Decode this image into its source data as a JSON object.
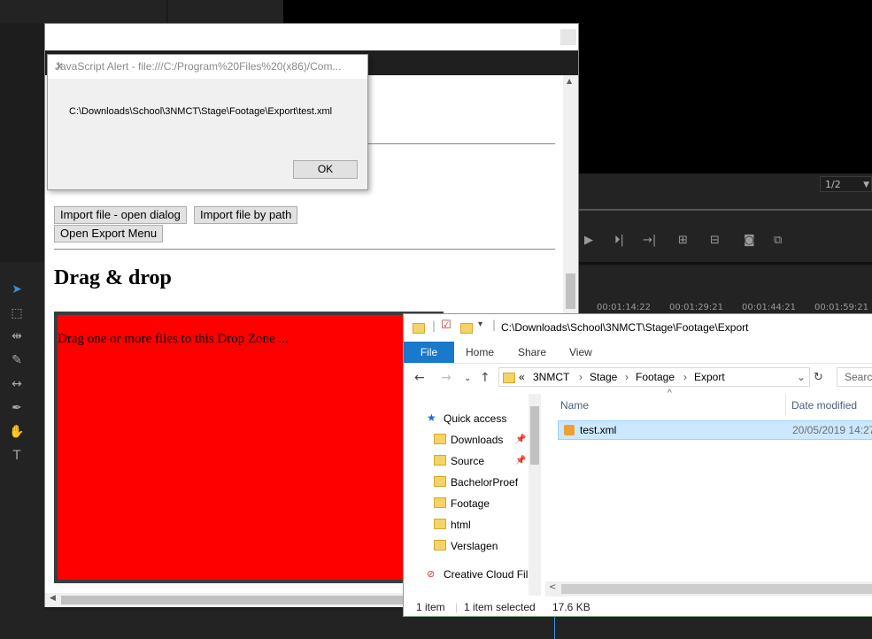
{
  "premiere": {
    "ratio": "1/2",
    "timecodes": [
      "00:01:14:22",
      "00:01:29:21",
      "00:01:44:21",
      "00:01:59:21"
    ]
  },
  "alert": {
    "title": "JavaScript Alert - file:///C:/Program%20Files%20(x86)/Com...",
    "message": "C:\\Downloads\\School\\3NMCT\\Stage\\Footage\\Export\\test.xml",
    "ok_label": "OK"
  },
  "page": {
    "buttons": {
      "import_dialog": "Import file - open dialog",
      "import_path": "Import file by path",
      "export_menu": "Open Export Menu"
    },
    "dragdrop_heading": "Drag & drop",
    "dropzone_text": "Drag one or more files to this Drop Zone ..."
  },
  "explorer": {
    "title_path": "C:\\Downloads\\School\\3NMCT\\Stage\\Footage\\Export",
    "ribbon_tabs": [
      "File",
      "Home",
      "Share",
      "View"
    ],
    "breadcrumb_prefix": "«",
    "breadcrumbs": [
      "3NMCT",
      "Stage",
      "Footage",
      "Export"
    ],
    "search_placeholder": "Search",
    "nav": {
      "quick_access": "Quick access",
      "items": [
        "Downloads",
        "Source",
        "BachelorProef",
        "Footage",
        "html",
        "Verslagen"
      ],
      "creative_cloud": "Creative Cloud Fil"
    },
    "columns": {
      "name": "Name",
      "date": "Date modified"
    },
    "files": [
      {
        "name": "test.xml",
        "date": "20/05/2019 14:27"
      }
    ],
    "status": {
      "count": "1 item",
      "selected": "1 item selected",
      "size": "17.6 KB"
    }
  },
  "colors": {
    "dropzone": "#ff0000",
    "ribbon_file": "#1979ca",
    "selection": "#cce8ff"
  }
}
